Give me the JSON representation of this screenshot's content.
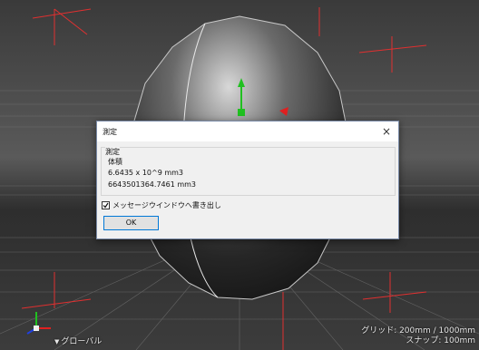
{
  "dialog": {
    "title": "測定",
    "close_glyph": "×",
    "group_label": "測定",
    "measure_name": "体積",
    "value_scientific": "6.6435 x 10^9 mm3",
    "value_full": "6643501364.7461 mm3",
    "checkbox_label": "メッセージウインドウへ書き出し",
    "checkbox_checked": true,
    "ok_label": "OK"
  },
  "viewport": {
    "grid_info": "グリッド: 200mm / 1000mm",
    "snap_info": "スナップ: 100mm",
    "coord_mode": "グローバル",
    "coord_mode_icon": "triangle-down-icon",
    "gizmo_colors": {
      "x": "#e02020",
      "y": "#20c020",
      "z": "#2040e0"
    },
    "bounds_color": "#e03030"
  }
}
